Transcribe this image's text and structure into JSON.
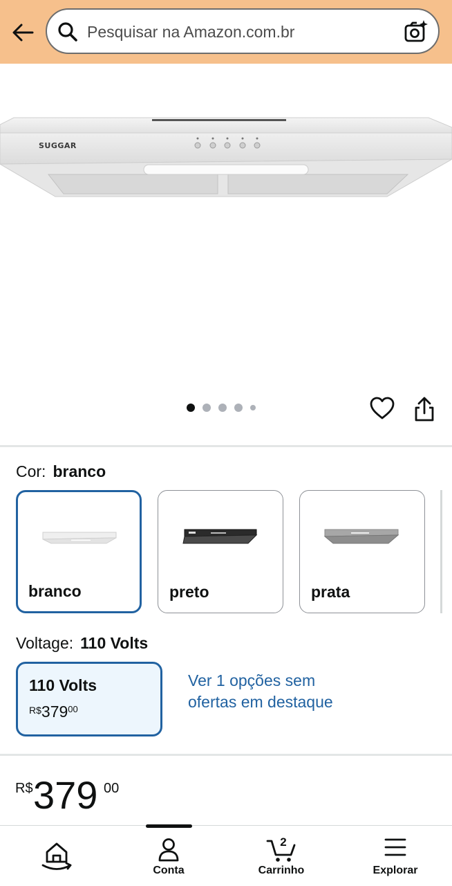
{
  "search": {
    "placeholder": "Pesquisar na Amazon.com.br"
  },
  "product": {
    "brand_on_image": "SUGGAR",
    "image_count": 5,
    "active_image_index": 0
  },
  "color": {
    "label": "Cor:",
    "selected": "branco",
    "options": [
      {
        "label": "branco",
        "selected": true
      },
      {
        "label": "preto",
        "selected": false
      },
      {
        "label": "prata",
        "selected": false
      }
    ]
  },
  "voltage": {
    "label": "Voltage:",
    "selected": "110 Volts",
    "option": {
      "title": "110 Volts",
      "currency": "R$",
      "price_whole": "379",
      "price_cents": "00"
    },
    "more_options_link": "Ver 1 opções sem ofertas em destaque"
  },
  "price": {
    "currency": "R$",
    "whole": "379",
    "cents": "00"
  },
  "bottom_nav": {
    "items": [
      {
        "label": "",
        "icon": "home-icon"
      },
      {
        "label": "Conta",
        "icon": "account-icon"
      },
      {
        "label": "Carrinho",
        "icon": "cart-icon",
        "count": "2"
      },
      {
        "label": "Explorar",
        "icon": "menu-icon"
      }
    ]
  },
  "colors": {
    "header_bg": "#f6c08c",
    "link": "#2162a1",
    "selected_border": "#2162a1",
    "selected_bg": "#edf6fd"
  }
}
